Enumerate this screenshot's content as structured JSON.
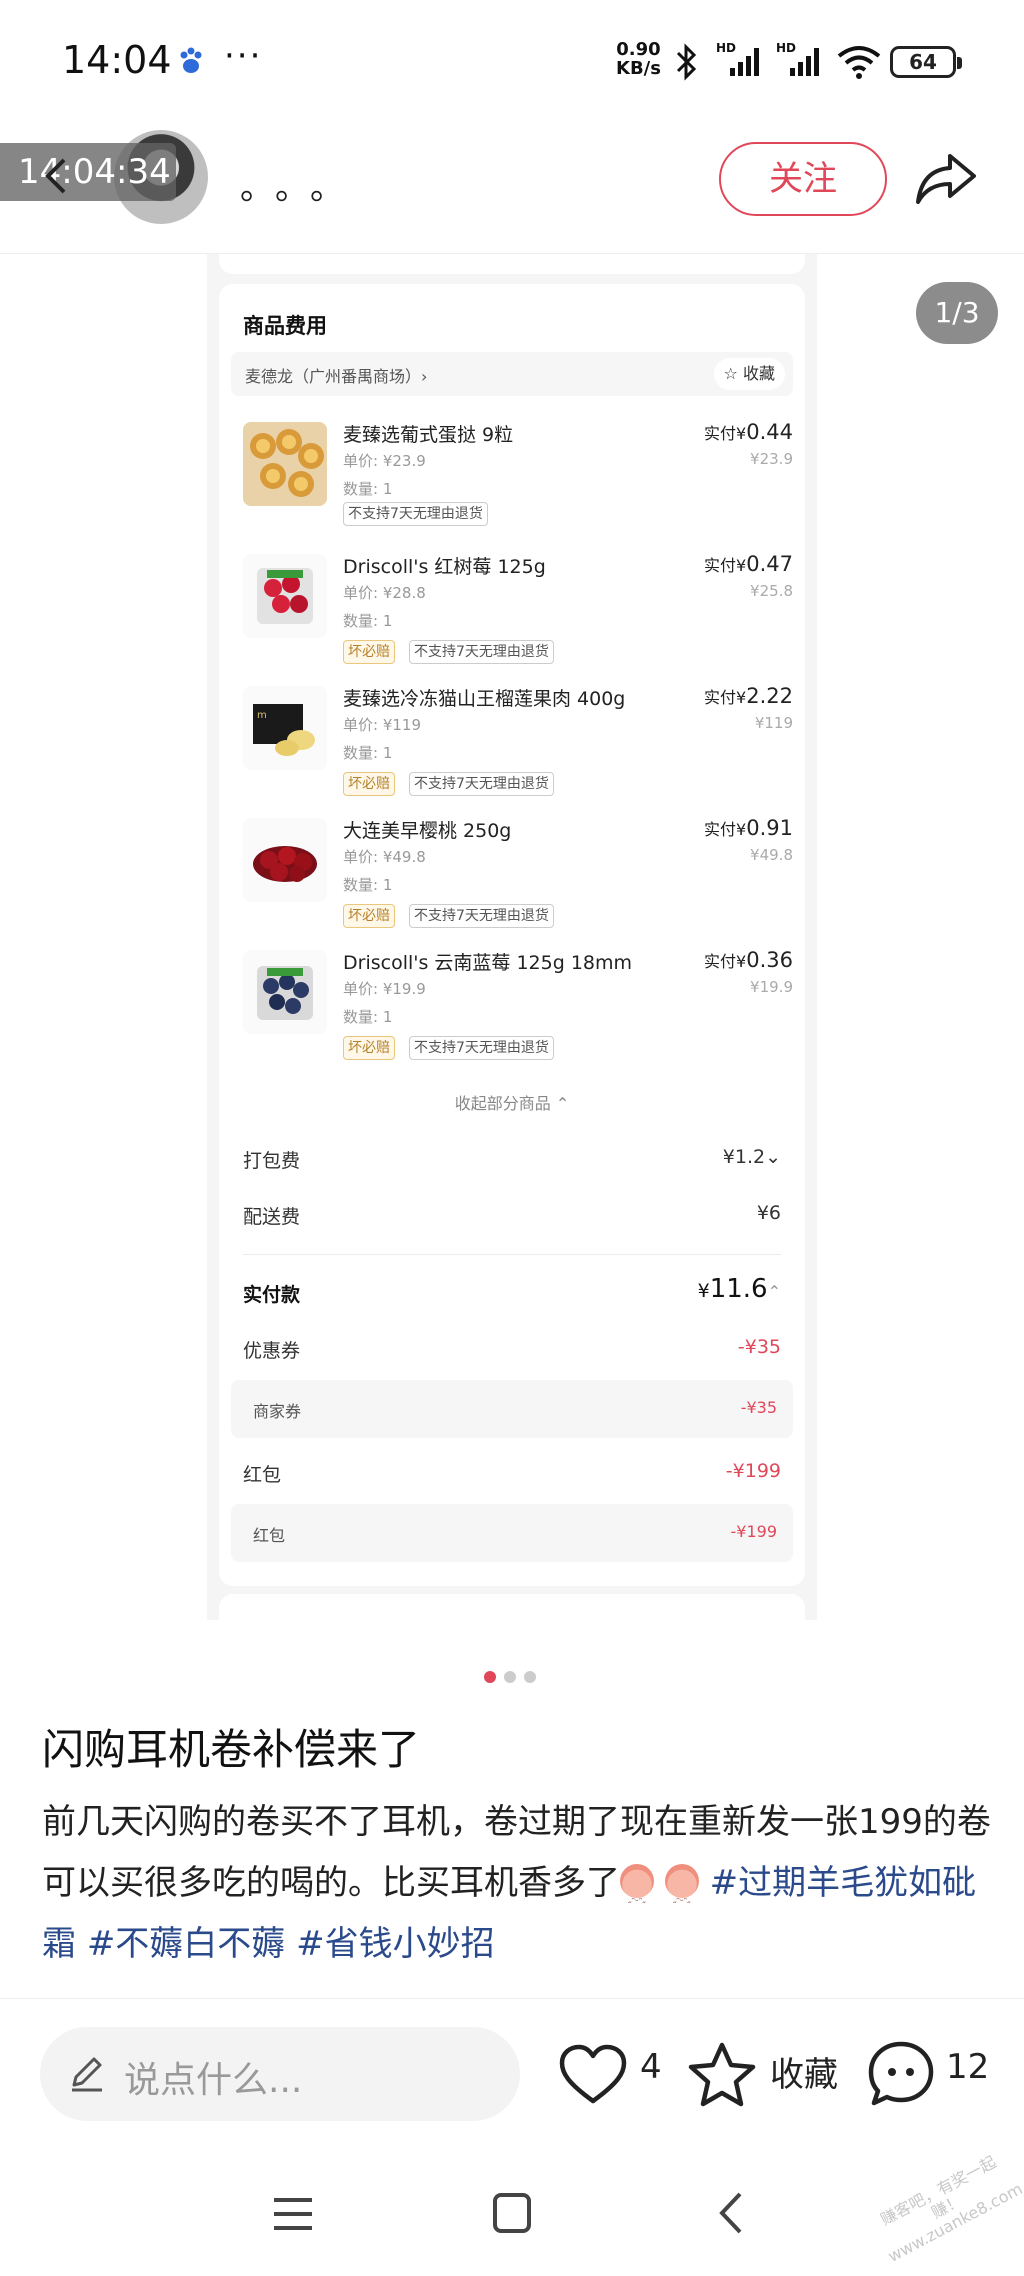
{
  "status_bar": {
    "time": "14:04",
    "dots": "···",
    "speed_value": "0.90",
    "speed_unit": "KB/s",
    "battery": "64"
  },
  "header": {
    "timestamp_overlay": "14:04:34",
    "author_name": "。。。",
    "follow_label": "关注"
  },
  "image_viewer": {
    "page_counter": "1/3",
    "card_title": "商品费用",
    "store_name": "麦德龙（广州番禺商场）›",
    "store_fav": "收藏",
    "items": [
      {
        "name": "麦臻选葡式蛋挞 9粒",
        "unit_price": "单价: ¥23.9",
        "qty": "数量: 1",
        "tags": [
          "不支持7天无理由退货"
        ],
        "paid_prefix": "实付¥",
        "paid": "0.44",
        "orig": "¥23.9",
        "thumb": "egg-tart"
      },
      {
        "name": "Driscoll's 红树莓 125g",
        "unit_price": "单价: ¥28.8",
        "qty": "数量: 1",
        "tags": [
          "坏必赔",
          "不支持7天无理由退货"
        ],
        "paid_prefix": "实付¥",
        "paid": "0.47",
        "orig": "¥25.8",
        "thumb": "raspberry"
      },
      {
        "name": "麦臻选冷冻猫山王榴莲果肉 400g",
        "unit_price": "单价: ¥119",
        "qty": "数量: 1",
        "tags": [
          "坏必赔",
          "不支持7天无理由退货"
        ],
        "paid_prefix": "实付¥",
        "paid": "2.22",
        "orig": "¥119",
        "thumb": "durian"
      },
      {
        "name": "大连美早樱桃 250g",
        "unit_price": "单价: ¥49.8",
        "qty": "数量: 1",
        "tags": [
          "坏必赔",
          "不支持7天无理由退货"
        ],
        "paid_prefix": "实付¥",
        "paid": "0.91",
        "orig": "¥49.8",
        "thumb": "cherry"
      },
      {
        "name": "Driscoll's 云南蓝莓 125g 18mm",
        "unit_price": "单价: ¥19.9",
        "qty": "数量: 1",
        "tags": [
          "坏必赔",
          "不支持7天无理由退货"
        ],
        "paid_prefix": "实付¥",
        "paid": "0.36",
        "orig": "¥19.9",
        "thumb": "blueberry"
      }
    ],
    "collapse_label": "收起部分商品 ⌃",
    "packing_fee_label": "打包费",
    "packing_fee": "¥1.2⌄",
    "delivery_fee_label": "配送费",
    "delivery_fee": "¥6",
    "total_label": "实付款",
    "total_prefix": "¥",
    "total": "11.6",
    "total_chevron": "⌃",
    "coupon_label": "优惠券",
    "coupon_value": "-¥35",
    "merchant_coupon_label": "商家券",
    "merchant_coupon_value": "-¥35",
    "redpacket_label": "红包",
    "redpacket_value": "-¥199",
    "redpacket_sub_label": "红包",
    "redpacket_sub_value": "-¥199",
    "pages": 3,
    "active_page": 1
  },
  "post": {
    "title": "闪购耳机卷补偿来了",
    "body_text": "前几天闪购的卷买不了耳机，卷过期了现在重新发一张199的卷  可以买很多吃的喝的。比买耳机香多了",
    "hashtags": [
      "#过期羊毛犹如砒霜",
      "#不薅白不薅",
      "#省钱小妙招"
    ]
  },
  "bottom_bar": {
    "comment_placeholder": "说点什么...",
    "like_count": "4",
    "fav_label": "收藏",
    "comment_count": "12"
  },
  "watermark": "赚客吧，有奖一起赚！www.zuanke8.com",
  "colors": {
    "accent": "#e0485a",
    "hashtag": "#2b4a8b",
    "tag_yellow": "#b5802a"
  }
}
